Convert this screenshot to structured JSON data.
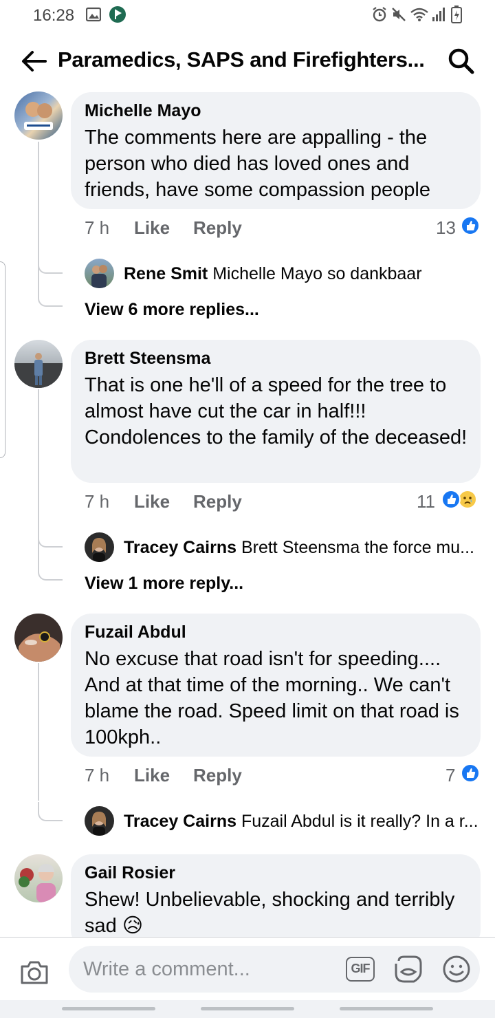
{
  "status_bar": {
    "time": "16:28",
    "icons": [
      "image-icon",
      "app-badge-icon",
      "alarm-icon",
      "mute-icon",
      "wifi-icon",
      "signal-icon",
      "battery-icon"
    ]
  },
  "header": {
    "title": "Paramedics, SAPS and Firefighters...",
    "back_icon": "arrow-left-icon",
    "search_icon": "search-icon"
  },
  "comments": [
    {
      "author": "Michelle Mayo",
      "text": "The comments here are appalling - the person who died has loved ones and friends, have some compassion people",
      "time": "7 h",
      "like_label": "Like",
      "reply_label": "Reply",
      "reaction_count": "13",
      "reactions": [
        "like"
      ],
      "replies": [
        {
          "author": "Rene Smit",
          "text": "Michelle Mayo so dankbaar"
        }
      ],
      "view_more": "View 6 more replies..."
    },
    {
      "author": "Brett Steensma",
      "text": "That is one he'll of a speed for the tree to almost have cut the car in half!!! Condolences to the family of the deceased!",
      "time": "7 h",
      "like_label": "Like",
      "reply_label": "Reply",
      "reaction_count": "11",
      "reactions": [
        "like",
        "sad"
      ],
      "replies": [
        {
          "author": "Tracey Cairns",
          "text": "Brett Steensma the force mu..."
        }
      ],
      "view_more": "View 1 more reply..."
    },
    {
      "author": "Fuzail Abdul",
      "text": "No excuse that road isn't for speeding.... And at that time of the morning.. We can't blame the road. Speed limit on that road is 100kph..",
      "time": "7 h",
      "like_label": "Like",
      "reply_label": "Reply",
      "reaction_count": "7",
      "reactions": [
        "like"
      ],
      "replies": [
        {
          "author": "Tracey Cairns",
          "text": "Fuzail Abdul is it really? In a r..."
        }
      ]
    },
    {
      "author": "Gail Rosier",
      "text": "Shew! Unbelievable, shocking and terribly sad 😥"
    }
  ],
  "composer": {
    "placeholder": "Write a comment...",
    "gif_label": "GIF",
    "icons": [
      "camera-icon",
      "gif-icon",
      "sticker-icon",
      "emoji-icon"
    ]
  },
  "colors": {
    "accent": "#1877f2",
    "bubble": "#f0f2f5",
    "secondary_text": "#65676b"
  }
}
